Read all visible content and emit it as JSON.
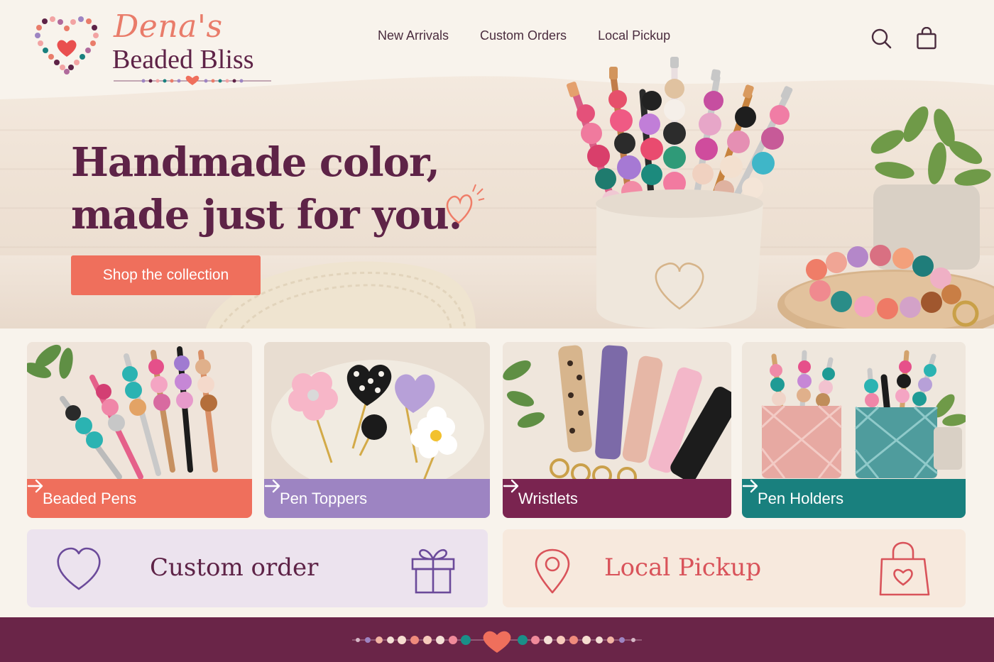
{
  "brand": {
    "script_name": "Dena's",
    "main_name": "Beaded Bliss",
    "logo_icon": "beaded-heart-icon"
  },
  "nav": {
    "items": [
      {
        "label": "New Arrivals"
      },
      {
        "label": "Custom Orders"
      },
      {
        "label": "Local Pickup"
      }
    ],
    "search_icon": "search-icon",
    "cart_icon": "shopping-bag-icon"
  },
  "hero": {
    "title": "Handmade color, made just for you.",
    "cta_label": "Shop the collection",
    "decor_icon": "heart-doodle-icon"
  },
  "categories": [
    {
      "label": "Beaded Pens",
      "color": "#ef6f5c",
      "icon": "arrow-right-icon"
    },
    {
      "label": "Pen Toppers",
      "color": "#9d84c2",
      "icon": "arrow-right-icon"
    },
    {
      "label": "Wristlets",
      "color": "#7a2450",
      "icon": "arrow-right-icon"
    },
    {
      "label": "Pen Holders",
      "color": "#19807e",
      "icon": "arrow-right-icon"
    }
  ],
  "panels": {
    "custom": {
      "title": "Custom order",
      "left_icon": "heart-outline-icon",
      "right_icon": "gift-icon",
      "bg": "#ece3ee",
      "color": "#5e2347"
    },
    "pickup": {
      "title": "Local Pickup",
      "left_icon": "map-pin-icon",
      "right_icon": "heart-bag-icon",
      "bg": "#f7e9dd",
      "color": "#d9535a"
    }
  },
  "colors": {
    "plum": "#5e2347",
    "coral": "#ef6f5c",
    "lavender": "#9d84c2",
    "teal": "#19807e",
    "cream": "#f8f3ec",
    "footer": "#6a2548"
  }
}
